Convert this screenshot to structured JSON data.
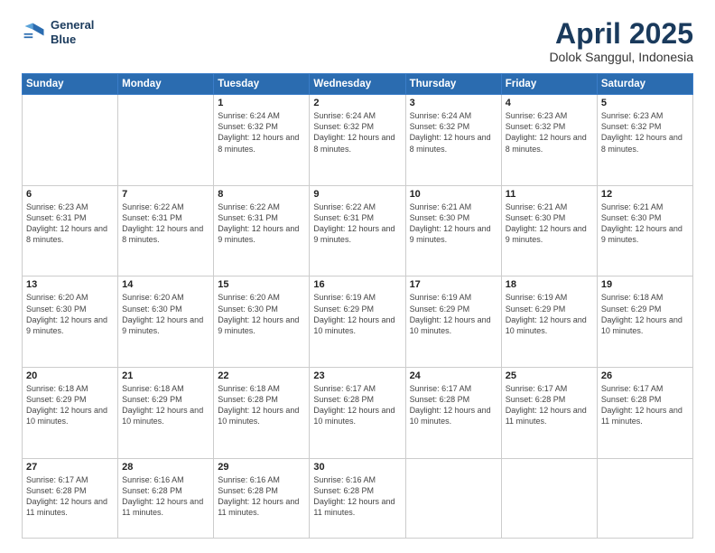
{
  "header": {
    "logo_line1": "General",
    "logo_line2": "Blue",
    "month_title": "April 2025",
    "location": "Dolok Sanggul, Indonesia"
  },
  "weekdays": [
    "Sunday",
    "Monday",
    "Tuesday",
    "Wednesday",
    "Thursday",
    "Friday",
    "Saturday"
  ],
  "weeks": [
    [
      {
        "day": "",
        "info": ""
      },
      {
        "day": "",
        "info": ""
      },
      {
        "day": "1",
        "info": "Sunrise: 6:24 AM\nSunset: 6:32 PM\nDaylight: 12 hours and 8 minutes."
      },
      {
        "day": "2",
        "info": "Sunrise: 6:24 AM\nSunset: 6:32 PM\nDaylight: 12 hours and 8 minutes."
      },
      {
        "day": "3",
        "info": "Sunrise: 6:24 AM\nSunset: 6:32 PM\nDaylight: 12 hours and 8 minutes."
      },
      {
        "day": "4",
        "info": "Sunrise: 6:23 AM\nSunset: 6:32 PM\nDaylight: 12 hours and 8 minutes."
      },
      {
        "day": "5",
        "info": "Sunrise: 6:23 AM\nSunset: 6:32 PM\nDaylight: 12 hours and 8 minutes."
      }
    ],
    [
      {
        "day": "6",
        "info": "Sunrise: 6:23 AM\nSunset: 6:31 PM\nDaylight: 12 hours and 8 minutes."
      },
      {
        "day": "7",
        "info": "Sunrise: 6:22 AM\nSunset: 6:31 PM\nDaylight: 12 hours and 8 minutes."
      },
      {
        "day": "8",
        "info": "Sunrise: 6:22 AM\nSunset: 6:31 PM\nDaylight: 12 hours and 9 minutes."
      },
      {
        "day": "9",
        "info": "Sunrise: 6:22 AM\nSunset: 6:31 PM\nDaylight: 12 hours and 9 minutes."
      },
      {
        "day": "10",
        "info": "Sunrise: 6:21 AM\nSunset: 6:30 PM\nDaylight: 12 hours and 9 minutes."
      },
      {
        "day": "11",
        "info": "Sunrise: 6:21 AM\nSunset: 6:30 PM\nDaylight: 12 hours and 9 minutes."
      },
      {
        "day": "12",
        "info": "Sunrise: 6:21 AM\nSunset: 6:30 PM\nDaylight: 12 hours and 9 minutes."
      }
    ],
    [
      {
        "day": "13",
        "info": "Sunrise: 6:20 AM\nSunset: 6:30 PM\nDaylight: 12 hours and 9 minutes."
      },
      {
        "day": "14",
        "info": "Sunrise: 6:20 AM\nSunset: 6:30 PM\nDaylight: 12 hours and 9 minutes."
      },
      {
        "day": "15",
        "info": "Sunrise: 6:20 AM\nSunset: 6:30 PM\nDaylight: 12 hours and 9 minutes."
      },
      {
        "day": "16",
        "info": "Sunrise: 6:19 AM\nSunset: 6:29 PM\nDaylight: 12 hours and 10 minutes."
      },
      {
        "day": "17",
        "info": "Sunrise: 6:19 AM\nSunset: 6:29 PM\nDaylight: 12 hours and 10 minutes."
      },
      {
        "day": "18",
        "info": "Sunrise: 6:19 AM\nSunset: 6:29 PM\nDaylight: 12 hours and 10 minutes."
      },
      {
        "day": "19",
        "info": "Sunrise: 6:18 AM\nSunset: 6:29 PM\nDaylight: 12 hours and 10 minutes."
      }
    ],
    [
      {
        "day": "20",
        "info": "Sunrise: 6:18 AM\nSunset: 6:29 PM\nDaylight: 12 hours and 10 minutes."
      },
      {
        "day": "21",
        "info": "Sunrise: 6:18 AM\nSunset: 6:29 PM\nDaylight: 12 hours and 10 minutes."
      },
      {
        "day": "22",
        "info": "Sunrise: 6:18 AM\nSunset: 6:28 PM\nDaylight: 12 hours and 10 minutes."
      },
      {
        "day": "23",
        "info": "Sunrise: 6:17 AM\nSunset: 6:28 PM\nDaylight: 12 hours and 10 minutes."
      },
      {
        "day": "24",
        "info": "Sunrise: 6:17 AM\nSunset: 6:28 PM\nDaylight: 12 hours and 10 minutes."
      },
      {
        "day": "25",
        "info": "Sunrise: 6:17 AM\nSunset: 6:28 PM\nDaylight: 12 hours and 11 minutes."
      },
      {
        "day": "26",
        "info": "Sunrise: 6:17 AM\nSunset: 6:28 PM\nDaylight: 12 hours and 11 minutes."
      }
    ],
    [
      {
        "day": "27",
        "info": "Sunrise: 6:17 AM\nSunset: 6:28 PM\nDaylight: 12 hours and 11 minutes."
      },
      {
        "day": "28",
        "info": "Sunrise: 6:16 AM\nSunset: 6:28 PM\nDaylight: 12 hours and 11 minutes."
      },
      {
        "day": "29",
        "info": "Sunrise: 6:16 AM\nSunset: 6:28 PM\nDaylight: 12 hours and 11 minutes."
      },
      {
        "day": "30",
        "info": "Sunrise: 6:16 AM\nSunset: 6:28 PM\nDaylight: 12 hours and 11 minutes."
      },
      {
        "day": "",
        "info": ""
      },
      {
        "day": "",
        "info": ""
      },
      {
        "day": "",
        "info": ""
      }
    ]
  ]
}
